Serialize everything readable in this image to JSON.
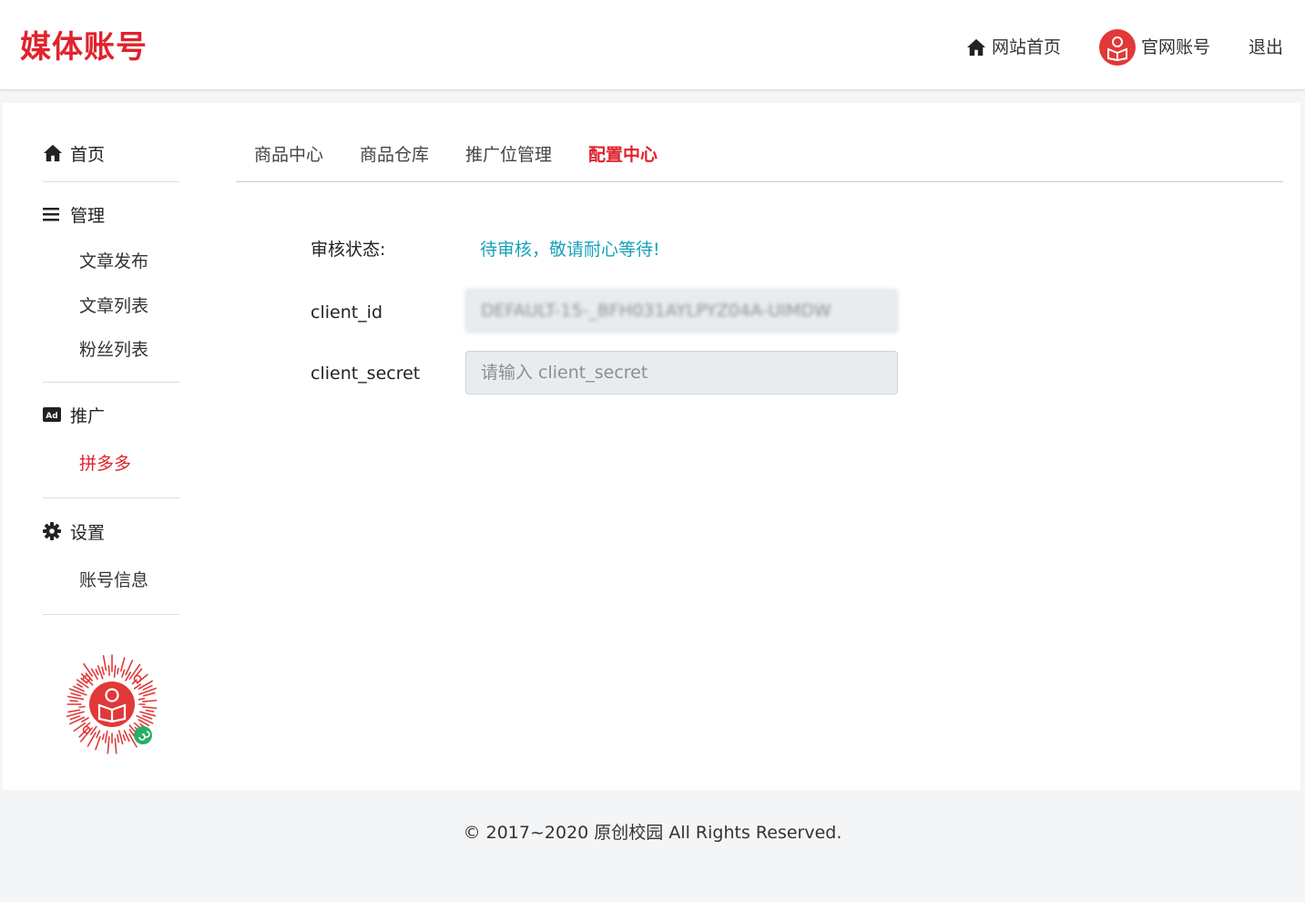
{
  "header": {
    "logo": "媒体账号",
    "links": [
      {
        "label": "网站首页",
        "icon": "home-icon"
      },
      {
        "label": "官网账号",
        "icon": "avatar-icon"
      },
      {
        "label": "退出"
      }
    ]
  },
  "sidebar": {
    "home": {
      "label": "首页",
      "icon": "home-icon"
    },
    "manage": {
      "label": "管理",
      "icon": "menu-icon",
      "items": [
        "文章发布",
        "文章列表",
        "粉丝列表"
      ]
    },
    "promo": {
      "label": "推广",
      "icon": "ad-icon",
      "items": [
        "拼多多"
      ],
      "active": "拼多多"
    },
    "settings": {
      "label": "设置",
      "icon": "gear-icon",
      "items": [
        "账号信息"
      ]
    }
  },
  "tabs": [
    {
      "label": "商品中心"
    },
    {
      "label": "商品仓库"
    },
    {
      "label": "推广位管理"
    },
    {
      "label": "配置中心",
      "active": true
    }
  ],
  "form": {
    "status_label": "审核状态:",
    "status_value": "待审核，敬请耐心等待!",
    "client_id_label": "client_id",
    "client_id_value": "DEFAULT-15-_BFH031AYLPYZ04A-UIMDW",
    "client_secret_label": "client_secret",
    "client_secret_placeholder": "请输入 client_secret"
  },
  "footer": {
    "copyright": "© 2017~2020 原创校园 All Rights Reserved."
  },
  "colors": {
    "brand": "#e0222c",
    "status": "#17a2b8",
    "mini_program_badge": "#2aae67"
  }
}
